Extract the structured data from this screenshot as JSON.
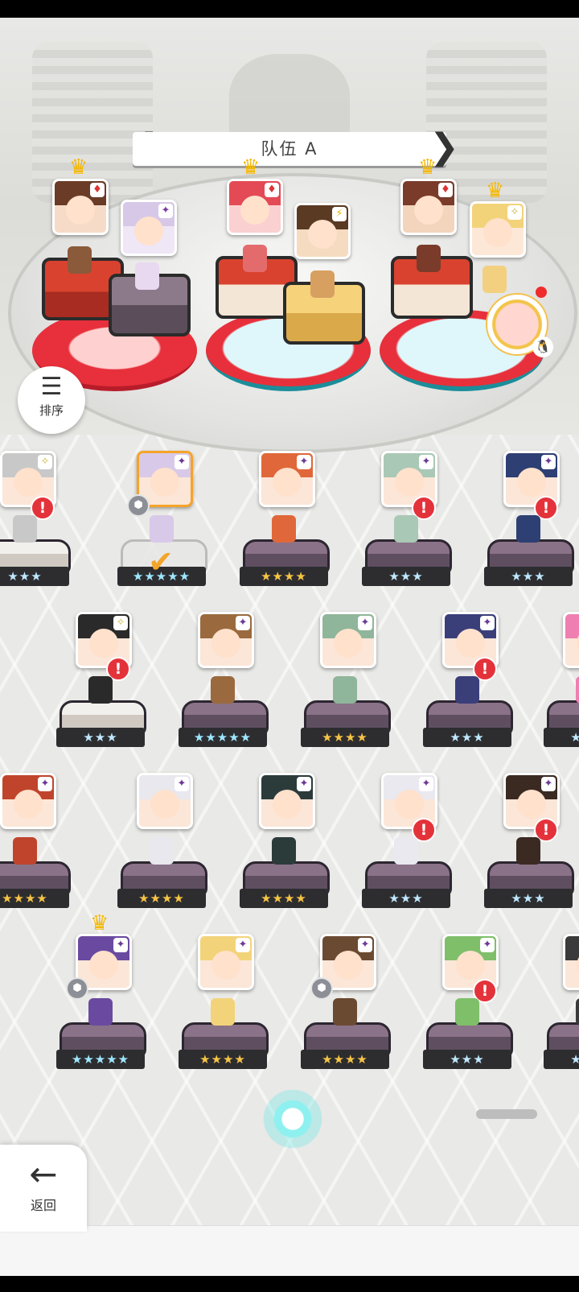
{
  "team": {
    "title": "队伍 A",
    "prev_label": "❮",
    "next_label": "❯"
  },
  "sort_button": {
    "icon": "sort-icon",
    "label": "排序"
  },
  "back_button": {
    "icon": "back-arrow-icon",
    "label": "返回"
  },
  "team_slots": [
    {
      "leader_element": "♦",
      "member_element": "✦",
      "leader_color": "#c8334a"
    },
    {
      "leader_element": "♦",
      "member_element": "⚡",
      "leader_color": "#e34a55"
    },
    {
      "leader_element": "♦",
      "member_element": "✧",
      "leader_color": "#7a3b2a"
    }
  ],
  "roster_rows": [
    {
      "cards": [
        {
          "stars": "★★★",
          "star_tier": "blue",
          "element": "✧",
          "warn": true,
          "hair": "#c8c8c8"
        },
        {
          "stars": "★★★★★",
          "star_tier": "rainbow",
          "element": "✦",
          "selected": true,
          "locked": true,
          "hair": "#d9c9e8"
        },
        {
          "stars": "★★★★",
          "star_tier": "gold",
          "element": "✦",
          "hair": "#e0673a"
        },
        {
          "stars": "★★★",
          "star_tier": "blue",
          "element": "✦",
          "warn": true,
          "hair": "#a9c8b5"
        },
        {
          "stars": "★★★",
          "star_tier": "blue",
          "element": "✦",
          "warn": true,
          "hair": "#2d3f73"
        }
      ]
    },
    {
      "cards": [
        {
          "stars": "★★★",
          "star_tier": "blue",
          "element": "✧",
          "warn": true,
          "hair": "#2a2a2a"
        },
        {
          "stars": "★★★★★",
          "star_tier": "rainbow",
          "element": "✦",
          "hair": "#9a6a3e"
        },
        {
          "stars": "★★★★",
          "star_tier": "gold",
          "element": "✦",
          "hair": "#8fb59a"
        },
        {
          "stars": "★★★",
          "star_tier": "blue",
          "element": "✦",
          "warn": true,
          "hair": "#3a3f7a"
        },
        {
          "stars": "★★★",
          "star_tier": "blue",
          "element": "✦",
          "hair": "#f07fb1"
        }
      ]
    },
    {
      "cards": [
        {
          "stars": "★★★★",
          "star_tier": "gold",
          "element": "✦",
          "hair": "#c0442c"
        },
        {
          "stars": "★★★★",
          "star_tier": "gold",
          "element": "✦",
          "hair": "#e8e8ee"
        },
        {
          "stars": "★★★★",
          "star_tier": "gold",
          "element": "✦",
          "hair": "#2b3b3a"
        },
        {
          "stars": "★★★",
          "star_tier": "blue",
          "element": "✦",
          "warn": true,
          "hair": "#e9e9ef"
        },
        {
          "stars": "★★★",
          "star_tier": "blue",
          "element": "✦",
          "warn": true,
          "hair": "#3a2a22"
        }
      ]
    },
    {
      "cards": [
        {
          "stars": "★★★★★",
          "star_tier": "rainbow",
          "element": "✦",
          "crown": true,
          "locked": true,
          "hair": "#6a4aa0"
        },
        {
          "stars": "★★★★",
          "star_tier": "gold",
          "element": "✦",
          "hair": "#f3d37a"
        },
        {
          "stars": "★★★★",
          "star_tier": "gold",
          "element": "✦",
          "locked": true,
          "hair": "#6b4a32"
        },
        {
          "stars": "★★★",
          "star_tier": "blue",
          "element": "✦",
          "warn": true,
          "hair": "#7fbf6a"
        },
        {
          "stars": "★★★",
          "star_tier": "blue",
          "element": "✦",
          "hair": "#3a3a3a"
        }
      ]
    }
  ]
}
